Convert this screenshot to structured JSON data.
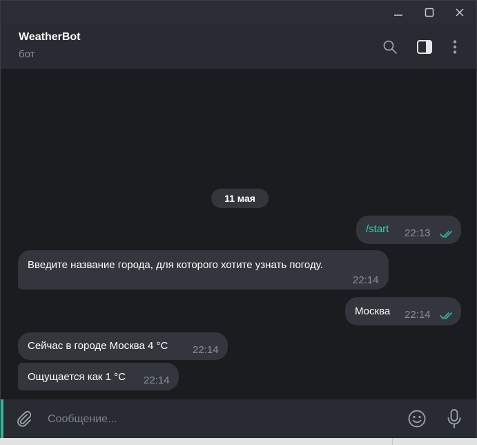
{
  "window": {
    "controls": [
      "minimize-icon",
      "maximize-icon",
      "close-icon"
    ]
  },
  "header": {
    "title": "WeatherBot",
    "subtitle": "бот",
    "icons": [
      "search-icon",
      "sidebar-toggle-icon",
      "more-vertical-icon"
    ]
  },
  "chat": {
    "date_separator": "11 мая",
    "messages": [
      {
        "direction": "out",
        "text": "/start",
        "time": "22:13",
        "status": "read"
      },
      {
        "direction": "in",
        "text": "Введите название города, для которого хотите узнать погоду.",
        "time": "22:14"
      },
      {
        "direction": "out",
        "text": "Москва",
        "time": "22:14",
        "status": "read"
      },
      {
        "direction": "in",
        "text": "Сейчас в городе Москва 4 °C",
        "time": "22:14"
      },
      {
        "direction": "in",
        "text": "Ощущается как 1 °C",
        "time": "22:14"
      }
    ]
  },
  "composer": {
    "placeholder": "Сообщение...",
    "value": "",
    "icons": [
      "attach-icon",
      "emoji-icon",
      "microphone-icon"
    ]
  },
  "colors": {
    "background": "#1b1c20",
    "header": "#282b31",
    "bubble": "#33363d",
    "accent": "#2fb59b",
    "link": "#3fcfb0",
    "muted": "#8a9099"
  }
}
